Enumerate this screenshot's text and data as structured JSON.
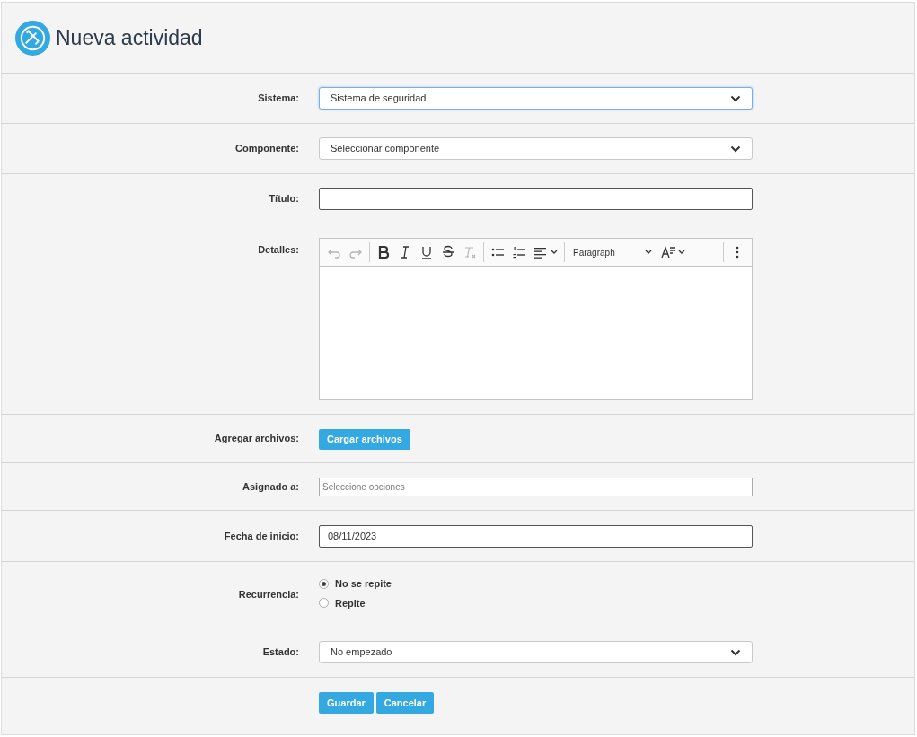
{
  "title": "Nueva actividad",
  "fields": [
    {
      "kind": "select",
      "label": "Sistema:",
      "value": "Sistema de seguridad",
      "focused": true
    },
    {
      "kind": "select",
      "label": "Componente:",
      "value": "Seleccionar componente",
      "focused": false
    },
    {
      "kind": "text",
      "label": "Título:"
    },
    {
      "kind": "editor",
      "label": "Detalles:",
      "format": "Paragraph",
      "toolbar": [
        {
          "kind": "undo",
          "disabled": true
        },
        {
          "kind": "redo",
          "disabled": true
        },
        {
          "kind": "sep"
        },
        {
          "kind": "bold",
          "disabled": false
        },
        {
          "kind": "italic",
          "disabled": false
        },
        {
          "kind": "underline",
          "disabled": false
        },
        {
          "kind": "strike",
          "disabled": false
        },
        {
          "kind": "clear",
          "disabled": true
        },
        {
          "kind": "sep"
        },
        {
          "kind": "bullets",
          "disabled": false
        },
        {
          "kind": "numbers",
          "disabled": false
        },
        {
          "kind": "align",
          "disabled": false
        },
        {
          "kind": "sep"
        },
        {
          "kind": "format",
          "disabled": false
        },
        {
          "kind": "fontsize",
          "disabled": false
        },
        {
          "kind": "sep"
        },
        {
          "kind": "more",
          "disabled": false
        }
      ]
    },
    {
      "kind": "upload",
      "label": "Agregar archivos:",
      "button": "Cargar archivos"
    },
    {
      "kind": "multiselect",
      "label": "Asignado a:",
      "placeholder": "Seleccione opciones"
    },
    {
      "kind": "date",
      "label": "Fecha de inicio:",
      "value": "08/11/2023"
    },
    {
      "kind": "radio",
      "label": "Recurrencia:",
      "options": [
        {
          "label": "No se repite",
          "selected": true
        },
        {
          "label": "Repite",
          "selected": false
        }
      ]
    },
    {
      "kind": "select",
      "label": "Estado:",
      "value": "No empezado",
      "focused": false
    },
    {
      "kind": "actions",
      "buttons": [
        "Guardar",
        "Cancelar"
      ]
    }
  ]
}
